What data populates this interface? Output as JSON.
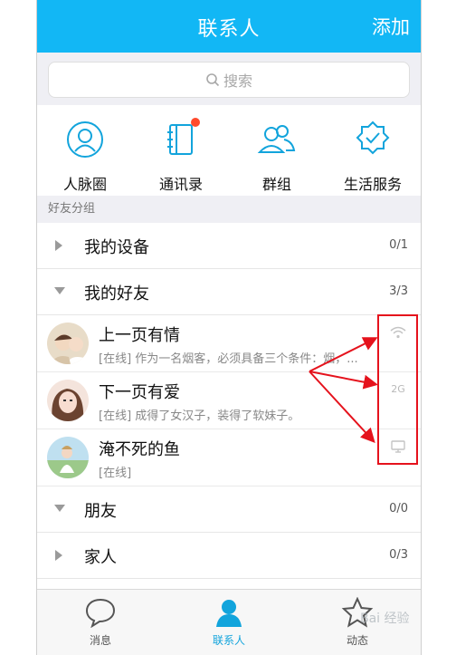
{
  "header": {
    "title": "联系人",
    "add_label": "添加"
  },
  "search": {
    "placeholder": "搜索"
  },
  "quick_actions": [
    {
      "label": "人脉圈",
      "icon": "contacts-circle-icon"
    },
    {
      "label": "通讯录",
      "icon": "address-book-icon"
    },
    {
      "label": "群组",
      "icon": "group-icon"
    },
    {
      "label": "生活服务",
      "icon": "life-service-icon"
    }
  ],
  "section_label": "好友分组",
  "groups": [
    {
      "name": "我的设备",
      "count": "0/1",
      "expanded": false
    },
    {
      "name": "我的好友",
      "count": "3/3",
      "expanded": true
    },
    {
      "name": "朋友",
      "count": "0/0",
      "expanded": true
    },
    {
      "name": "家人",
      "count": "0/3",
      "expanded": false
    }
  ],
  "friends": [
    {
      "name": "上一页有情",
      "signature": "[在线] 作为一名烟客，必须具备三个条件：烟，...",
      "status": "wifi",
      "status_text": ""
    },
    {
      "name": "下一页有爱",
      "signature": "[在线] 成得了女汉子，装得了软妹子。",
      "status": "2g",
      "status_text": "2G"
    },
    {
      "name": "淹不死的鱼",
      "signature": "[在线]",
      "status": "desktop",
      "status_text": ""
    }
  ],
  "tabs": [
    {
      "label": "消息",
      "icon": "message-bubble-icon",
      "active": false
    },
    {
      "label": "联系人",
      "icon": "contact-person-icon",
      "active": true
    },
    {
      "label": "动态",
      "icon": "star-icon",
      "active": false
    }
  ],
  "colors": {
    "accent": "#12b7f5",
    "badge": "#ff4a2d",
    "annotation": "#e5121c"
  },
  "watermark": "Bai 经验"
}
